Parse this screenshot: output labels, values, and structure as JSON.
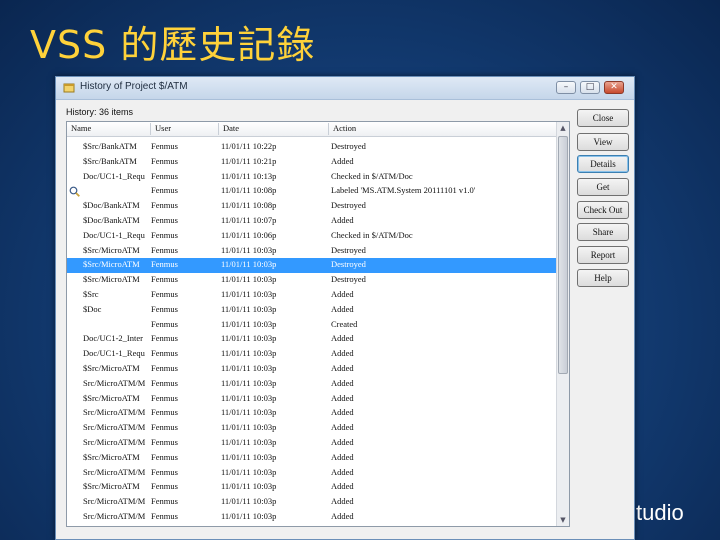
{
  "slide": {
    "title": "VSS 的歷史記錄",
    "brand_text": "tudio"
  },
  "window": {
    "title": "History of Project $/ATM",
    "minimize": "–",
    "maximize": "□",
    "close": "✕",
    "history_count": "History: 36 items",
    "columns": {
      "name": "Name",
      "user": "User",
      "date": "Date",
      "action": "Action"
    }
  },
  "rows": [
    {
      "name": "$Src/BankATM",
      "user": "Fenmus",
      "date": "11/01/11 10:22p",
      "action": "Destroyed"
    },
    {
      "name": "$Src/BankATM",
      "user": "Fenmus",
      "date": "11/01/11 10:21p",
      "action": "Added"
    },
    {
      "name": "Doc/UC1-1_Requ",
      "user": "Fenmus",
      "date": "11/01/11 10:13p",
      "action": "Checked in $/ATM/Doc"
    },
    {
      "name": "",
      "user": "Fenmus",
      "date": "11/01/11 10:08p",
      "action": "Labeled 'MS.ATM.System 20111101 v1.0'",
      "label_icon": true
    },
    {
      "name": "$Doc/BankATM",
      "user": "Fenmus",
      "date": "11/01/11 10:08p",
      "action": "Destroyed"
    },
    {
      "name": "$Doc/BankATM",
      "user": "Fenmus",
      "date": "11/01/11 10:07p",
      "action": "Added"
    },
    {
      "name": "Doc/UC1-1_Requ",
      "user": "Fenmus",
      "date": "11/01/11 10:06p",
      "action": "Checked in $/ATM/Doc"
    },
    {
      "name": "$Src/MicroATM",
      "user": "Fenmus",
      "date": "11/01/11 10:03p",
      "action": "Destroyed"
    },
    {
      "name": "$Src/MicroATM",
      "user": "Fenmus",
      "date": "11/01/11 10:03p",
      "action": "Destroyed",
      "selected": true
    },
    {
      "name": "$Src/MicroATM",
      "user": "Fenmus",
      "date": "11/01/11 10:03p",
      "action": "Destroyed"
    },
    {
      "name": "$Src",
      "user": "Fenmus",
      "date": "11/01/11 10:03p",
      "action": "Added"
    },
    {
      "name": "$Doc",
      "user": "Fenmus",
      "date": "11/01/11 10:03p",
      "action": "Added"
    },
    {
      "name": "",
      "user": "Fenmus",
      "date": "11/01/11 10:03p",
      "action": "Created"
    },
    {
      "name": "Doc/UC1-2_Inter",
      "user": "Fenmus",
      "date": "11/01/11 10:03p",
      "action": "Added"
    },
    {
      "name": "Doc/UC1-1_Requ",
      "user": "Fenmus",
      "date": "11/01/11 10:03p",
      "action": "Added"
    },
    {
      "name": "$Src/MicroATM",
      "user": "Fenmus",
      "date": "11/01/11 10:03p",
      "action": "Added"
    },
    {
      "name": "Src/MicroATM/M",
      "user": "Fenmus",
      "date": "11/01/11 10:03p",
      "action": "Added"
    },
    {
      "name": "$Src/MicroATM",
      "user": "Fenmus",
      "date": "11/01/11 10:03p",
      "action": "Added"
    },
    {
      "name": "Src/MicroATM/M",
      "user": "Fenmus",
      "date": "11/01/11 10:03p",
      "action": "Added"
    },
    {
      "name": "Src/MicroATM/M",
      "user": "Fenmus",
      "date": "11/01/11 10:03p",
      "action": "Added"
    },
    {
      "name": "Src/MicroATM/M",
      "user": "Fenmus",
      "date": "11/01/11 10:03p",
      "action": "Added"
    },
    {
      "name": "$Src/MicroATM",
      "user": "Fenmus",
      "date": "11/01/11 10:03p",
      "action": "Added"
    },
    {
      "name": "Src/MicroATM/M",
      "user": "Fenmus",
      "date": "11/01/11 10:03p",
      "action": "Added"
    },
    {
      "name": "$Src/MicroATM",
      "user": "Fenmus",
      "date": "11/01/11 10:03p",
      "action": "Added"
    },
    {
      "name": "Src/MicroATM/M",
      "user": "Fenmus",
      "date": "11/01/11 10:03p",
      "action": "Added"
    },
    {
      "name": "Src/MicroATM/M",
      "user": "Fenmus",
      "date": "11/01/11 10:03p",
      "action": "Added"
    }
  ],
  "buttons": {
    "close": "Close",
    "view": "View",
    "details": "Details",
    "get": "Get",
    "check_out": "Check Out",
    "share": "Share",
    "report": "Report",
    "help": "Help"
  }
}
